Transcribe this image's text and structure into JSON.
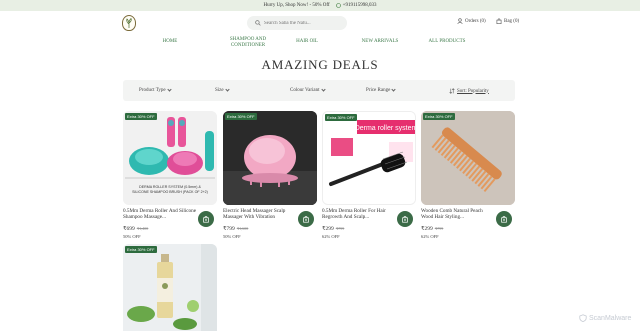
{
  "announcement": {
    "text": "Hurry Up, Shop Now! - 50% Off",
    "phone": "+919115998,033"
  },
  "header": {
    "search_placeholder": "Search Saba the Natu...",
    "orders_label": "Orders (0)",
    "bag_label": "Bag (0)"
  },
  "nav": [
    "HOME",
    "SHAMPOO AND CONDITIONER",
    "HAIR OIL",
    "NEW ARRIVALS",
    "ALL PRODUCTS"
  ],
  "page_title": "AMAZING DEALS",
  "filters": {
    "product_type": "Product Type",
    "size": "Size",
    "colour_variant": "Colour Variant",
    "price_range": "Price Range",
    "sort": "Sort: Popularity"
  },
  "products": [
    {
      "badge": "Extra 30% OFF",
      "image_caption": "DERMA ROLLER SYSTEM (0.5mm) & SILICONE SHAMPOO BRUSH (PACK OF 2+2)",
      "name": "0.5Mm Derma Roller And Silicone Shampoo Massage...",
      "price": "₹699",
      "old_price": "₹1,400",
      "off": "50% OFF"
    },
    {
      "badge": "Extra 30% OFF",
      "name": "Electric Head Massager Scalp Massager With Vibration",
      "price": "₹799",
      "old_price": "₹1,600",
      "off": "50% OFF"
    },
    {
      "badge": "Extra 30% OFF",
      "image_caption": "Derma roller system",
      "name": "0.5Mm Derma Roller For Hair Regrowth And Scalp...",
      "price": "₹299",
      "old_price": "₹799",
      "off": "62% OFF"
    },
    {
      "badge": "Extra 30% OFF",
      "name": "Wooden Comb Natural Peach Wood Hair Styling...",
      "price": "₹299",
      "old_price": "₹799",
      "off": "62% OFF"
    },
    {
      "badge": "Extra 30% OFF"
    }
  ],
  "watermark": "ScanMalware",
  "colors": {
    "brand_green": "#3b6b47",
    "nav_green": "#3d7a4a",
    "announce_bg": "#e8efe4"
  }
}
